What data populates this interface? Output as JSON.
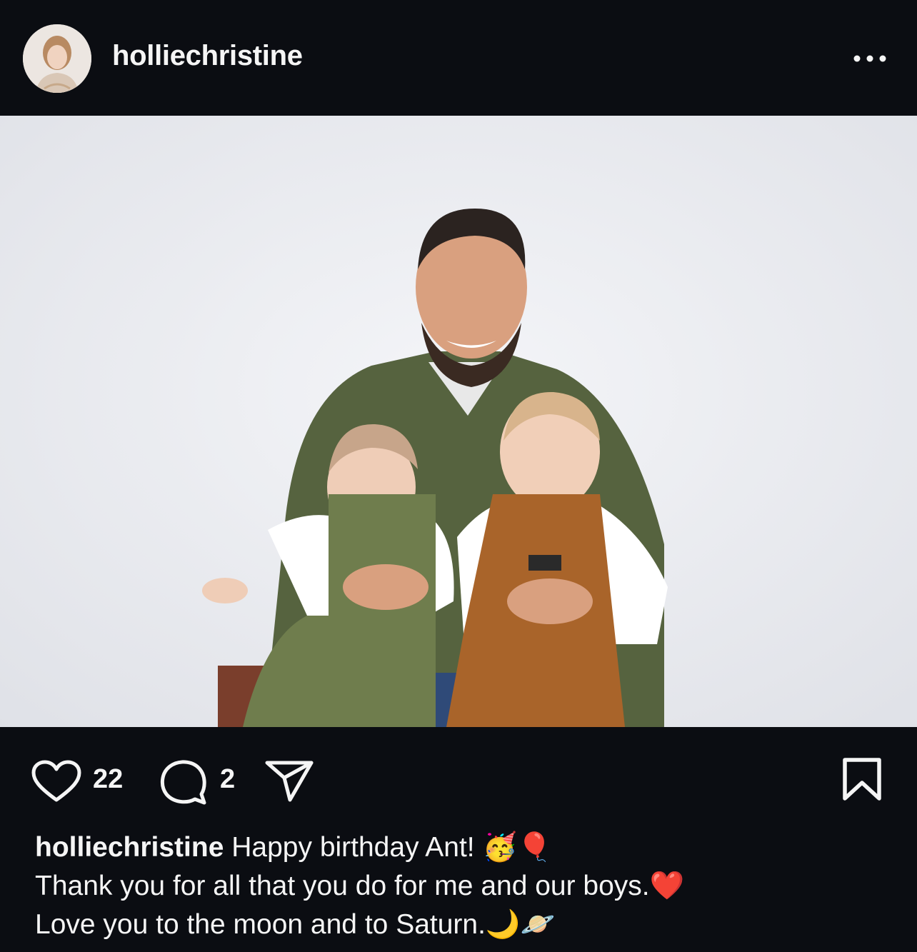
{
  "post": {
    "username": "holliechristine",
    "more_icon": "more-horizontal-icon"
  },
  "actions": {
    "likes": "22",
    "comments": "2",
    "like_icon": "heart-icon",
    "comment_icon": "comment-icon",
    "share_icon": "paper-plane-icon",
    "save_icon": "bookmark-icon"
  },
  "caption": {
    "username": "holliechristine",
    "line1": "Happy birthday Ant! 🥳🎈",
    "line2": "Thank you for all that you do for me and our boys.❤️",
    "line3": "Love you to the moon and to Saturn.🌙🪐"
  },
  "colors": {
    "background": "#0b0d12",
    "text": "#f5f5f5"
  }
}
